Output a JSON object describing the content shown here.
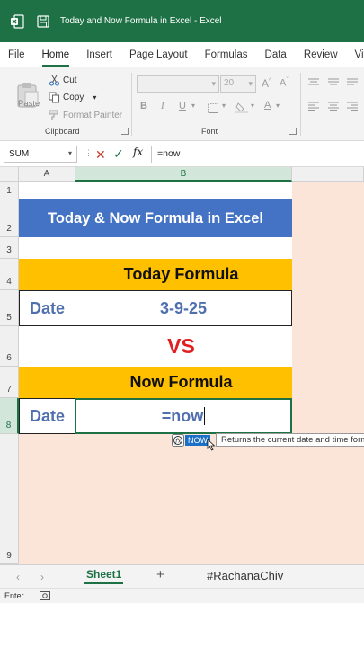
{
  "window": {
    "title": "Today and Now Formula in Excel  -  Excel"
  },
  "ribbon_tabs": [
    "File",
    "Home",
    "Insert",
    "Page Layout",
    "Formulas",
    "Data",
    "Review",
    "View"
  ],
  "clipboard": {
    "paste": "Paste",
    "cut": "Cut",
    "copy": "Copy",
    "format_painter": "Format Painter",
    "group_label": "Clipboard"
  },
  "font_group": {
    "size": "20",
    "group_label": "Font",
    "bold": "B",
    "italic": "I",
    "underline": "U"
  },
  "formula_bar": {
    "name_box": "SUM",
    "formula": "=now"
  },
  "columns": [
    "A",
    "B"
  ],
  "rows": [
    "1",
    "2",
    "3",
    "4",
    "5",
    "6",
    "7",
    "8",
    "9"
  ],
  "sheet": {
    "banner": "Today & Now Formula in Excel",
    "today_heading": "Today Formula",
    "date_label_1": "Date",
    "today_value": "3-9-25",
    "vs": "VS",
    "now_heading": "Now Formula",
    "date_label_2": "Date",
    "now_value": "=now"
  },
  "autocomplete": {
    "item": "NOW",
    "tooltip": "Returns the current date and time formatted"
  },
  "sheet_tabs": {
    "active": "Sheet1",
    "watermark": "#RachanaChiv"
  },
  "status": {
    "mode": "Enter"
  },
  "colors": {
    "excel_green": "#1e7145",
    "banner_blue": "#4472c4",
    "heading_gold": "#ffc000",
    "sheet_bg": "#fbe4d8",
    "vs_red": "#e02020"
  }
}
